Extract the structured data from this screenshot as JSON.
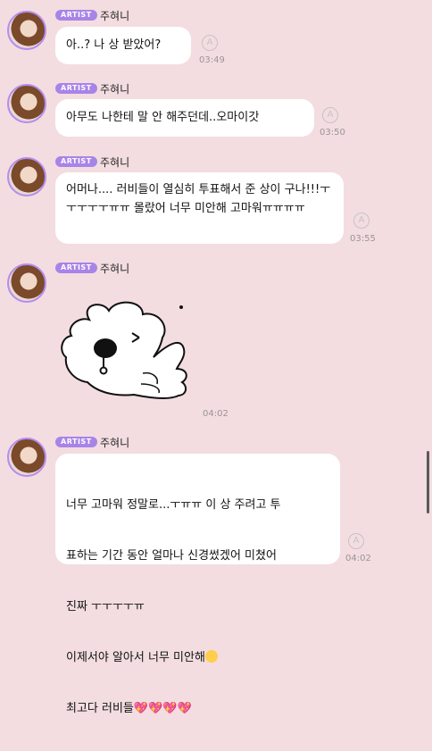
{
  "messages": [
    {
      "badge": "ARTIST",
      "name": "주혀니",
      "text": "아..? 나 상 받았어?",
      "time": "03:49"
    },
    {
      "badge": "ARTIST",
      "name": "주혀니",
      "text": "아무도 나한테 말 안 해주던데..오마이갓",
      "time": "03:50"
    },
    {
      "badge": "ARTIST",
      "name": "주혀니",
      "text": "어머나.... 러비들이 열심히 투표해서 준 상이 구나!!!ㅜㅜㅜㅜㅜㅠㅠ 몰랐어 너무 미안해 고마워ㅠㅠㅠㅠ",
      "time": "03:55"
    },
    {
      "badge": "ARTIST",
      "name": "주혀니",
      "sticker": "white-dog-thumbs-up-sticker",
      "time": "04:02"
    },
    {
      "badge": "ARTIST",
      "name": "주혀니",
      "text_lines": [
        "너무 고마워 정말로...ㅜㅠㅠ 이 상 주려고 투",
        "표하는 기간 동안 얼마나 신경썼겠어 미쳤어",
        "진짜 ㅜㅜㅜㅜㅠ",
        "이제서야 알아서 너무 미안해",
        "최고다 러비들"
      ],
      "hearts": "💖💖💖💖",
      "time": "04:02"
    }
  ],
  "read_icon_letter": "A"
}
